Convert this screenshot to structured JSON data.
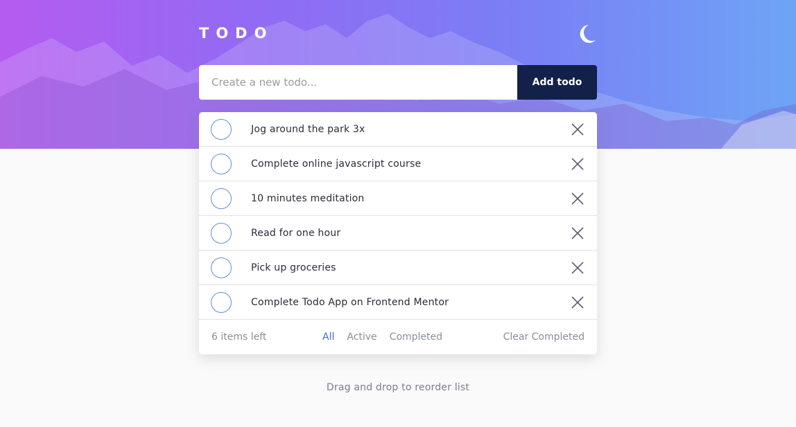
{
  "colors": {
    "accent": "#3b6fd8",
    "button_bg": "#13214a",
    "circle_border": "#5f8fd8"
  },
  "header": {
    "title": "TODO",
    "theme_icon": "moon-icon"
  },
  "new_todo": {
    "placeholder": "Create a new todo...",
    "add_label": "Add todo"
  },
  "todos": [
    {
      "text": "Jog around the park 3x"
    },
    {
      "text": "Complete online javascript course"
    },
    {
      "text": "10 minutes meditation"
    },
    {
      "text": "Read for one hour"
    },
    {
      "text": "Pick up groceries"
    },
    {
      "text": "Complete Todo App on Frontend Mentor"
    }
  ],
  "footer": {
    "items_left": "6 items left",
    "filters": [
      "All",
      "Active",
      "Completed"
    ],
    "active_filter": "All",
    "clear_label": "Clear Completed"
  },
  "hint": "Drag and drop to reorder list"
}
